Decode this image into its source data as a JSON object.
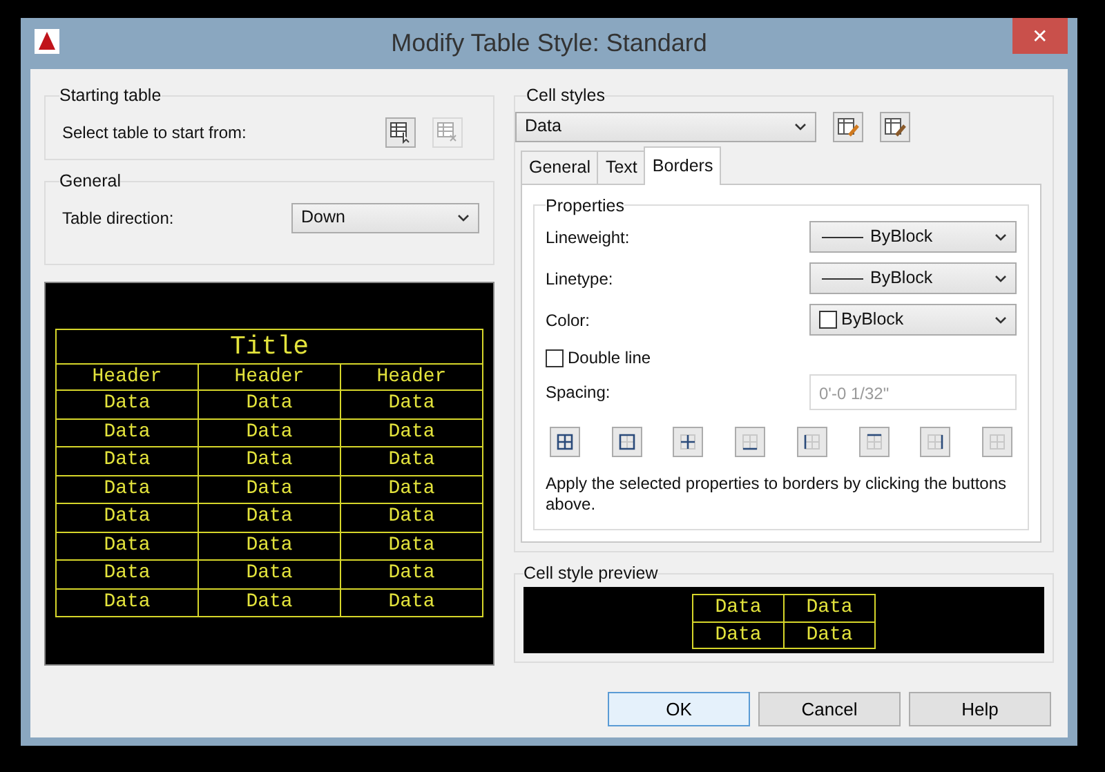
{
  "window": {
    "title": "Modify Table Style: Standard",
    "close": "✕"
  },
  "starting_table": {
    "legend": "Starting table",
    "label": "Select table to start from:",
    "buttons": [
      {
        "kind": "select",
        "disabled": false
      },
      {
        "kind": "remove",
        "disabled": true
      }
    ]
  },
  "general": {
    "legend": "General",
    "label": "Table direction:",
    "value": "Down"
  },
  "table_preview": {
    "title": "Title",
    "headers": [
      "Header",
      "Header",
      "Header"
    ],
    "rows": [
      [
        "Data",
        "Data",
        "Data"
      ],
      [
        "Data",
        "Data",
        "Data"
      ],
      [
        "Data",
        "Data",
        "Data"
      ],
      [
        "Data",
        "Data",
        "Data"
      ],
      [
        "Data",
        "Data",
        "Data"
      ],
      [
        "Data",
        "Data",
        "Data"
      ],
      [
        "Data",
        "Data",
        "Data"
      ],
      [
        "Data",
        "Data",
        "Data"
      ]
    ]
  },
  "cell_styles": {
    "legend": "Cell styles",
    "value": "Data",
    "tabs": [
      {
        "label": "General",
        "selected": false
      },
      {
        "label": "Text",
        "selected": false
      },
      {
        "label": "Borders",
        "selected": true
      }
    ],
    "properties": {
      "legend": "Properties",
      "fields": [
        {
          "kind": "line",
          "label": "Lineweight:",
          "value": "ByBlock"
        },
        {
          "kind": "line",
          "label": "Linetype:",
          "value": "ByBlock"
        },
        {
          "kind": "color",
          "label": "Color:",
          "value": "ByBlock"
        }
      ],
      "double_line": {
        "label": "Double line",
        "checked": false
      },
      "spacing": {
        "label": "Spacing:",
        "value": "0'-0 1/32\"",
        "disabled": true
      },
      "border_buttons": [
        {
          "kind": "all"
        },
        {
          "kind": "outside"
        },
        {
          "kind": "inside"
        },
        {
          "kind": "bottom"
        },
        {
          "kind": "left"
        },
        {
          "kind": "top"
        },
        {
          "kind": "right"
        },
        {
          "kind": "none"
        }
      ],
      "note": "Apply the selected properties to borders by clicking the buttons above."
    }
  },
  "cell_preview": {
    "legend": "Cell style preview",
    "rows": [
      [
        "Data",
        "Data"
      ],
      [
        "Data",
        "Data"
      ]
    ]
  },
  "buttons": [
    {
      "label": "OK",
      "default": true
    },
    {
      "label": "Cancel",
      "default": false
    },
    {
      "label": "Help",
      "default": false
    }
  ]
}
